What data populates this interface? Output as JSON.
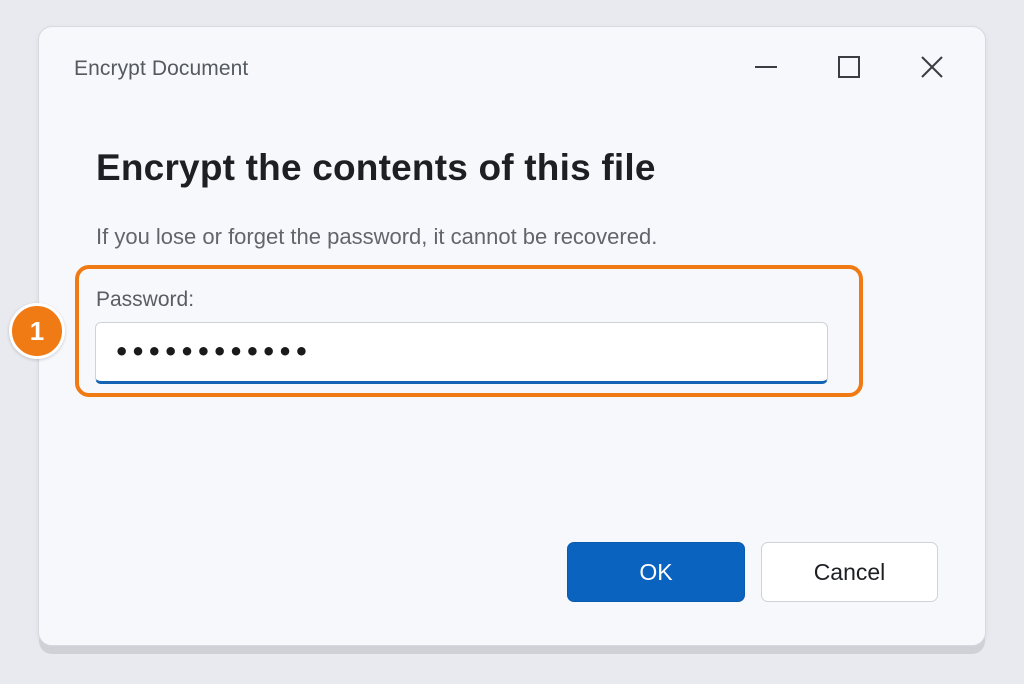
{
  "window": {
    "title": "Encrypt Document"
  },
  "title_bar_icons": {
    "minimize": "minimize-icon",
    "maximize": "maximize-icon",
    "close": "close-icon"
  },
  "content": {
    "heading": "Encrypt the contents of this file",
    "warning": "If you lose or forget the password, it cannot be recovered.",
    "password_label": "Password:",
    "password_value": "••••••••••••"
  },
  "annotation": {
    "step_number": "1",
    "color": "#f07a14"
  },
  "buttons": {
    "ok_label": "OK",
    "cancel_label": "Cancel"
  },
  "colors": {
    "accent": "#0b63c0",
    "input_focus_underline": "#1464b4"
  }
}
